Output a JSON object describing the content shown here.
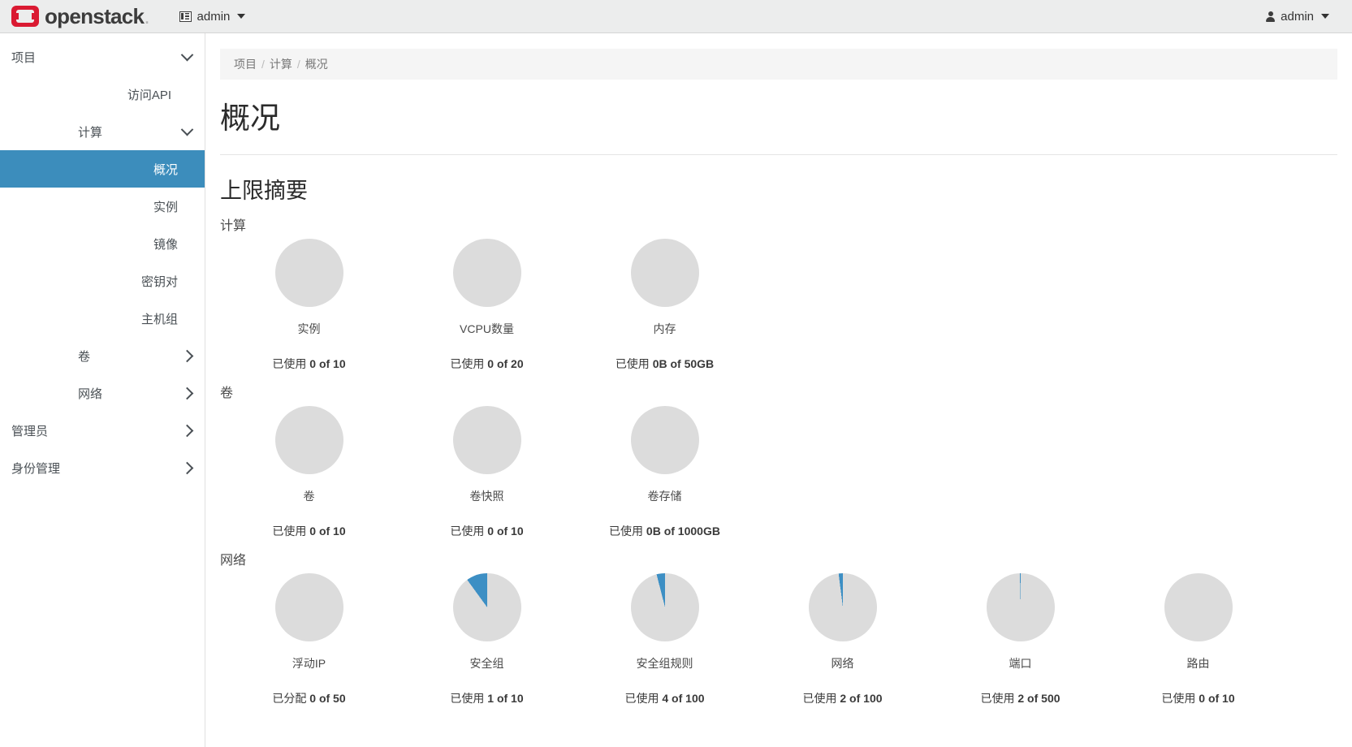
{
  "topbar": {
    "brand": "openstack",
    "brand_suffix": ".",
    "project_menu": "admin",
    "user_menu": "admin"
  },
  "sidebar": {
    "items": [
      {
        "label": "项目",
        "level": 1,
        "arrow": "down",
        "active": false
      },
      {
        "label": "访问API",
        "level": 2,
        "arrow": "",
        "active": false
      },
      {
        "label": "计算",
        "level": 2,
        "arrow": "down",
        "active": false
      },
      {
        "label": "概况",
        "level": 3,
        "arrow": "",
        "active": true
      },
      {
        "label": "实例",
        "level": 3,
        "arrow": "",
        "active": false
      },
      {
        "label": "镜像",
        "level": 3,
        "arrow": "",
        "active": false
      },
      {
        "label": "密钥对",
        "level": 3,
        "arrow": "",
        "active": false
      },
      {
        "label": "主机组",
        "level": 3,
        "arrow": "",
        "active": false
      },
      {
        "label": "卷",
        "level": 2,
        "arrow": "right",
        "active": false
      },
      {
        "label": "网络",
        "level": 2,
        "arrow": "right",
        "active": false
      },
      {
        "label": "管理员",
        "level": 1,
        "arrow": "right",
        "active": false
      },
      {
        "label": "身份管理",
        "level": 1,
        "arrow": "right",
        "active": false
      }
    ]
  },
  "breadcrumb": {
    "items": [
      "项目",
      "计算",
      "概况"
    ],
    "separator": "/"
  },
  "page": {
    "title": "概况",
    "section_title": "上限摘要"
  },
  "chart_data": [
    {
      "type": "pie",
      "title": "计算",
      "slices": [
        {
          "label": "实例",
          "used": 0,
          "limit": 10,
          "unit": "",
          "percent": 0,
          "prefix": "已使用",
          "used_display": "0",
          "limit_display": "10"
        },
        {
          "label": "VCPU数量",
          "used": 0,
          "limit": 20,
          "unit": "",
          "percent": 0,
          "prefix": "已使用",
          "used_display": "0",
          "limit_display": "20"
        },
        {
          "label": "内存",
          "used": 0,
          "limit": 50,
          "unit": "GB",
          "percent": 0,
          "prefix": "已使用",
          "used_display": "0B",
          "limit_display": "50GB"
        }
      ]
    },
    {
      "type": "pie",
      "title": "卷",
      "slices": [
        {
          "label": "卷",
          "used": 0,
          "limit": 10,
          "unit": "",
          "percent": 0,
          "prefix": "已使用",
          "used_display": "0",
          "limit_display": "10"
        },
        {
          "label": "卷快照",
          "used": 0,
          "limit": 10,
          "unit": "",
          "percent": 0,
          "prefix": "已使用",
          "used_display": "0",
          "limit_display": "10"
        },
        {
          "label": "卷存储",
          "used": 0,
          "limit": 1000,
          "unit": "GB",
          "percent": 0,
          "prefix": "已使用",
          "used_display": "0B",
          "limit_display": "1000GB"
        }
      ]
    },
    {
      "type": "pie",
      "title": "网络",
      "slices": [
        {
          "label": "浮动IP",
          "used": 0,
          "limit": 50,
          "unit": "",
          "percent": 0,
          "prefix": "已分配",
          "used_display": "0",
          "limit_display": "50"
        },
        {
          "label": "安全组",
          "used": 1,
          "limit": 10,
          "unit": "",
          "percent": 10,
          "prefix": "已使用",
          "used_display": "1",
          "limit_display": "10"
        },
        {
          "label": "安全组规则",
          "used": 4,
          "limit": 100,
          "unit": "",
          "percent": 4,
          "prefix": "已使用",
          "used_display": "4",
          "limit_display": "100"
        },
        {
          "label": "网络",
          "used": 2,
          "limit": 100,
          "unit": "",
          "percent": 2,
          "prefix": "已使用",
          "used_display": "2",
          "limit_display": "100"
        },
        {
          "label": "端口",
          "used": 2,
          "limit": 500,
          "unit": "",
          "percent": 0.4,
          "prefix": "已使用",
          "used_display": "2",
          "limit_display": "500"
        },
        {
          "label": "路由",
          "used": 0,
          "limit": 10,
          "unit": "",
          "percent": 0,
          "prefix": "已使用",
          "used_display": "0",
          "limit_display": "10"
        }
      ]
    }
  ],
  "colors": {
    "accent": "#3c8dbc",
    "pie_used": "#3d8fc4",
    "pie_free": "#dcdcdc",
    "brand_red": "#da1a32",
    "navbar_bg": "#eceded"
  }
}
